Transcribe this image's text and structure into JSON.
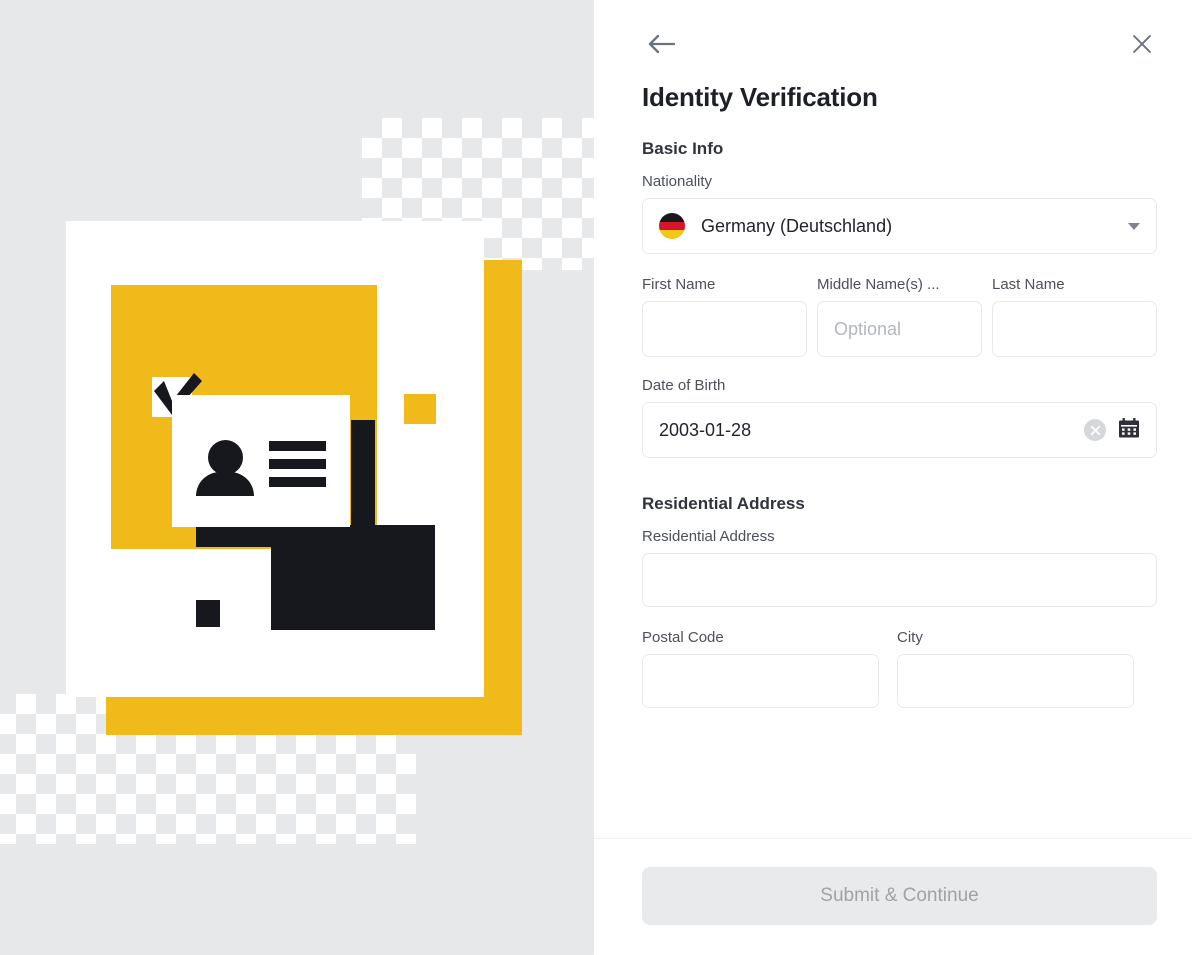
{
  "header": {
    "back_icon": "back-arrow-icon",
    "close_icon": "close-icon",
    "title": "Identity Verification"
  },
  "basic_info": {
    "section_title": "Basic Info",
    "nationality": {
      "label": "Nationality",
      "selected_value": "Germany (Deutschland)",
      "flag_icon": "germany-flag-icon",
      "chevron_icon": "chevron-down-icon"
    },
    "first_name": {
      "label": "First Name",
      "value": "",
      "placeholder": ""
    },
    "middle_name": {
      "label": "Middle Name(s) ...",
      "value": "",
      "placeholder": "Optional"
    },
    "last_name": {
      "label": "Last Name",
      "value": "",
      "placeholder": ""
    },
    "date_of_birth": {
      "label": "Date of Birth",
      "value": "2003-01-28",
      "clear_icon": "clear-circle-x-icon",
      "calendar_icon": "calendar-icon"
    }
  },
  "residential_address": {
    "section_title": "Residential Address",
    "address": {
      "label": "Residential Address",
      "value": "",
      "placeholder": ""
    },
    "postal_code": {
      "label": "Postal Code",
      "value": "",
      "placeholder": ""
    },
    "city": {
      "label": "City",
      "value": "",
      "placeholder": ""
    }
  },
  "footer": {
    "submit_label": "Submit & Continue"
  },
  "illustration": {
    "name": "identity-document-illustration",
    "colors": {
      "yellow": "#efba1a",
      "dark": "#16181d",
      "panel_background": "#e6e8ea",
      "card_white": "#ffffff"
    }
  },
  "theme": {
    "accent": "#efba1a",
    "text_primary": "#1d2026",
    "text_secondary": "#4b5059",
    "border": "#e8e9eb",
    "disabled_bg": "#e8eaec",
    "disabled_text": "#9fa3a9"
  }
}
